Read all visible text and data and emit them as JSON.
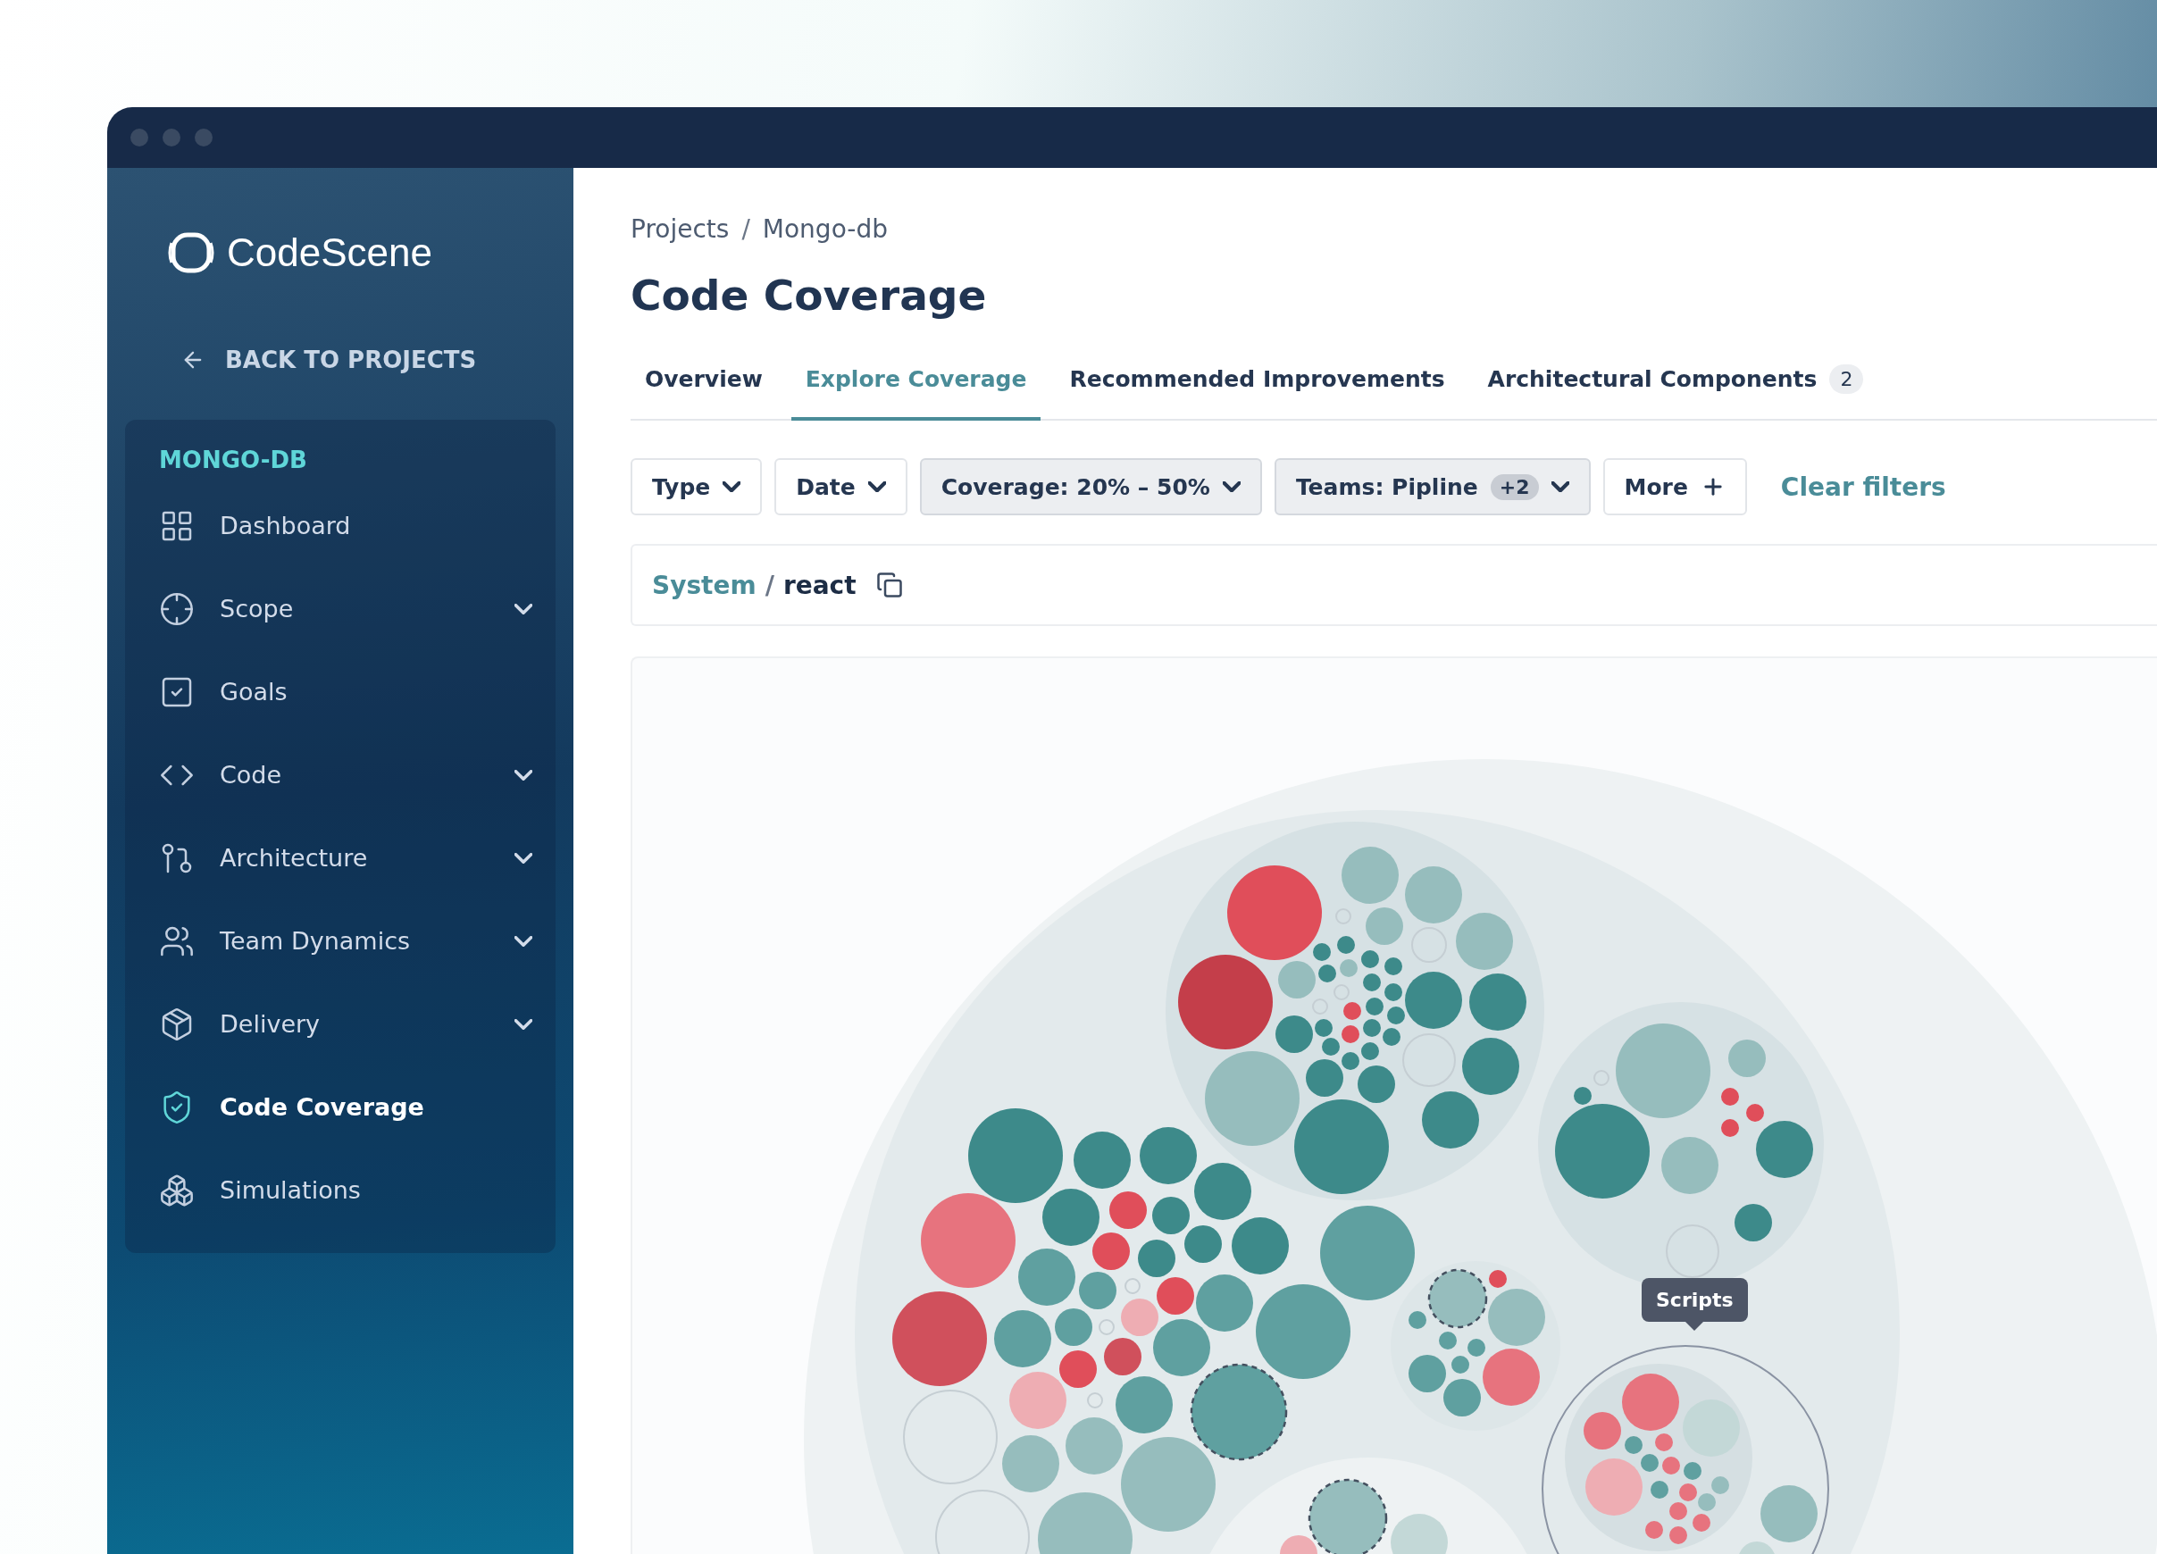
{
  "sidebar": {
    "logo": "CodeScene",
    "back_link": "BACK TO PROJECTS",
    "section_title": "MONGO-DB",
    "items": [
      {
        "label": "Dashboard",
        "has_submenu": false,
        "selected": false
      },
      {
        "label": "Scope",
        "has_submenu": true,
        "selected": false
      },
      {
        "label": "Goals",
        "has_submenu": false,
        "selected": false
      },
      {
        "label": "Code",
        "has_submenu": true,
        "selected": false
      },
      {
        "label": "Architecture",
        "has_submenu": true,
        "selected": false
      },
      {
        "label": "Team Dynamics",
        "has_submenu": true,
        "selected": false
      },
      {
        "label": "Delivery",
        "has_submenu": true,
        "selected": false
      },
      {
        "label": "Code Coverage",
        "has_submenu": false,
        "selected": true
      },
      {
        "label": "Simulations",
        "has_submenu": false,
        "selected": false
      }
    ]
  },
  "breadcrumb": [
    "Projects",
    "Mongo-db"
  ],
  "breadcrumb_separator": "/",
  "title": "Code Coverage",
  "tabs": [
    {
      "label": "Overview",
      "selected": false
    },
    {
      "label": "Explore Coverage",
      "selected": true
    },
    {
      "label": "Recommended Improvements",
      "selected": false
    },
    {
      "label": "Architectural Components",
      "selected": false,
      "badge": "2"
    }
  ],
  "filters": [
    {
      "label": "Type",
      "kind": "dropdown",
      "active": false
    },
    {
      "label": "Date",
      "kind": "dropdown",
      "active": false
    },
    {
      "label": "Coverage: 20% – 50%",
      "kind": "dropdown",
      "active": true
    },
    {
      "label": "Teams: Pipline",
      "kind": "dropdown",
      "active": true,
      "badge": "+2"
    },
    {
      "label": "More",
      "kind": "add",
      "active": false
    }
  ],
  "clear_filters": "Clear filters",
  "path": {
    "parent": "System",
    "separator": "/",
    "current": "react"
  },
  "chart": {
    "tooltip": "Scripts"
  }
}
